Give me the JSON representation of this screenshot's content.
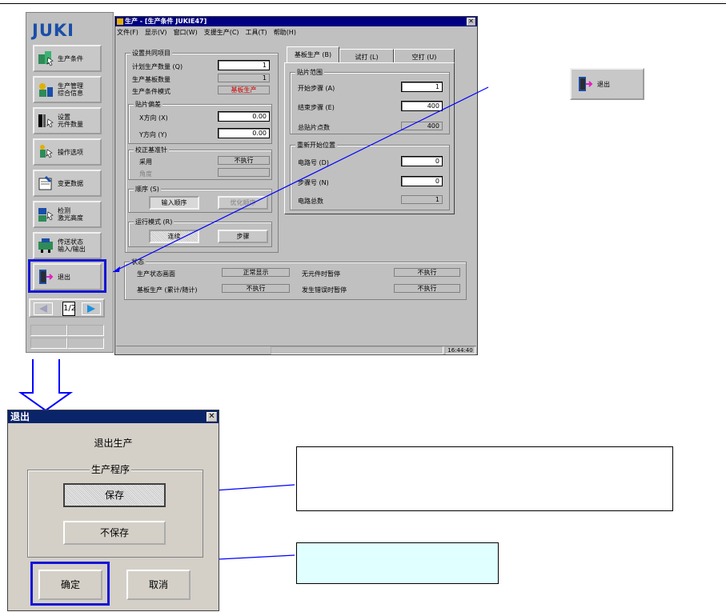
{
  "sidebar": {
    "logo": "JUKI",
    "buttons": [
      {
        "label": "生产条件",
        "icon": "production-icon"
      },
      {
        "label": "生产管理\n综合信息",
        "icon": "management-icon"
      },
      {
        "label": "设置\n元件数量",
        "icon": "component-count-icon"
      },
      {
        "label": "操作选项",
        "icon": "operation-icon"
      },
      {
        "label": "变更数据",
        "icon": "edit-data-icon"
      },
      {
        "label": "检测\n激光高度",
        "icon": "laser-icon"
      },
      {
        "label": "传送状态\n输入/输出",
        "icon": "io-icon"
      },
      {
        "label": "退出",
        "icon": "exit-door-icon"
      }
    ],
    "pager": {
      "page": "1/2"
    }
  },
  "main_window": {
    "title": "生产 - [生产条件 JUKIE47]",
    "menu": [
      "文件(F)",
      "显示(V)",
      "窗口(W)",
      "支援生产(C)",
      "工具(T)",
      "帮助(H)"
    ],
    "common": {
      "title": "设置共同项目",
      "plan_qty_label": "计划生产数量 (Q)",
      "plan_qty_value": "1",
      "board_qty_label": "生产基板数量",
      "board_qty_value": "1",
      "mode_label": "生产条件模式",
      "mode_value": "基板生产"
    },
    "offset": {
      "title": "贴片偏差",
      "x_label": "X方向 (X)",
      "x_value": "0.00",
      "y_label": "Y方向 (Y)",
      "y_value": "0.00"
    },
    "correction": {
      "title": "校正基准针",
      "adopt_label": "采用",
      "adopt_value": "不执行",
      "angle_label": "角度",
      "angle_value": ""
    },
    "order": {
      "title": "顺序 (S)",
      "btn_input": "输入顺序",
      "btn_optimize": "优化顺序"
    },
    "run_mode": {
      "title": "运行模式 (R)",
      "btn_continuous": "连续",
      "btn_step": "步骤"
    },
    "tabs": [
      "基板生产 (B)",
      "试打 (L)",
      "空打 (U)"
    ],
    "range": {
      "title": "贴片范围",
      "start_label": "开始步骤 (A)",
      "start_value": "1",
      "end_label": "结束步骤 (E)",
      "end_value": "400",
      "total_label": "总贴片点数",
      "total_value": "400"
    },
    "restart": {
      "title": "重新开始位置",
      "circuit_label": "电路号 (D)",
      "circuit_value": "0",
      "step_label": "步骤号 (N)",
      "step_value": "0",
      "total_circuit_label": "电路总数",
      "total_circuit_value": "1"
    },
    "status": {
      "title": "状态",
      "row1_label": "生产状态画面",
      "row1_value": "正常显示",
      "row1b_label": "无元件时暂停",
      "row1b_value": "不执行",
      "row2_label": "基板生产 (累计/随计)",
      "row2_value": "不执行",
      "row2b_label": "发生错误时暂停",
      "row2b_value": "不执行"
    },
    "clock": "16:44:40"
  },
  "exit_button_preview": {
    "label": "退出"
  },
  "dialog": {
    "title": "退出",
    "heading": "退出生产",
    "group_title": "生产程序",
    "save": "保存",
    "no_save": "不保存",
    "ok": "确定",
    "cancel": "取消"
  },
  "colors": {
    "highlight": "#1414d6",
    "arrow_line": "#0000ff",
    "titlebar": "#000080",
    "dialog_titlebar": "#0a246a",
    "callout_fill": "#e0ffff"
  }
}
